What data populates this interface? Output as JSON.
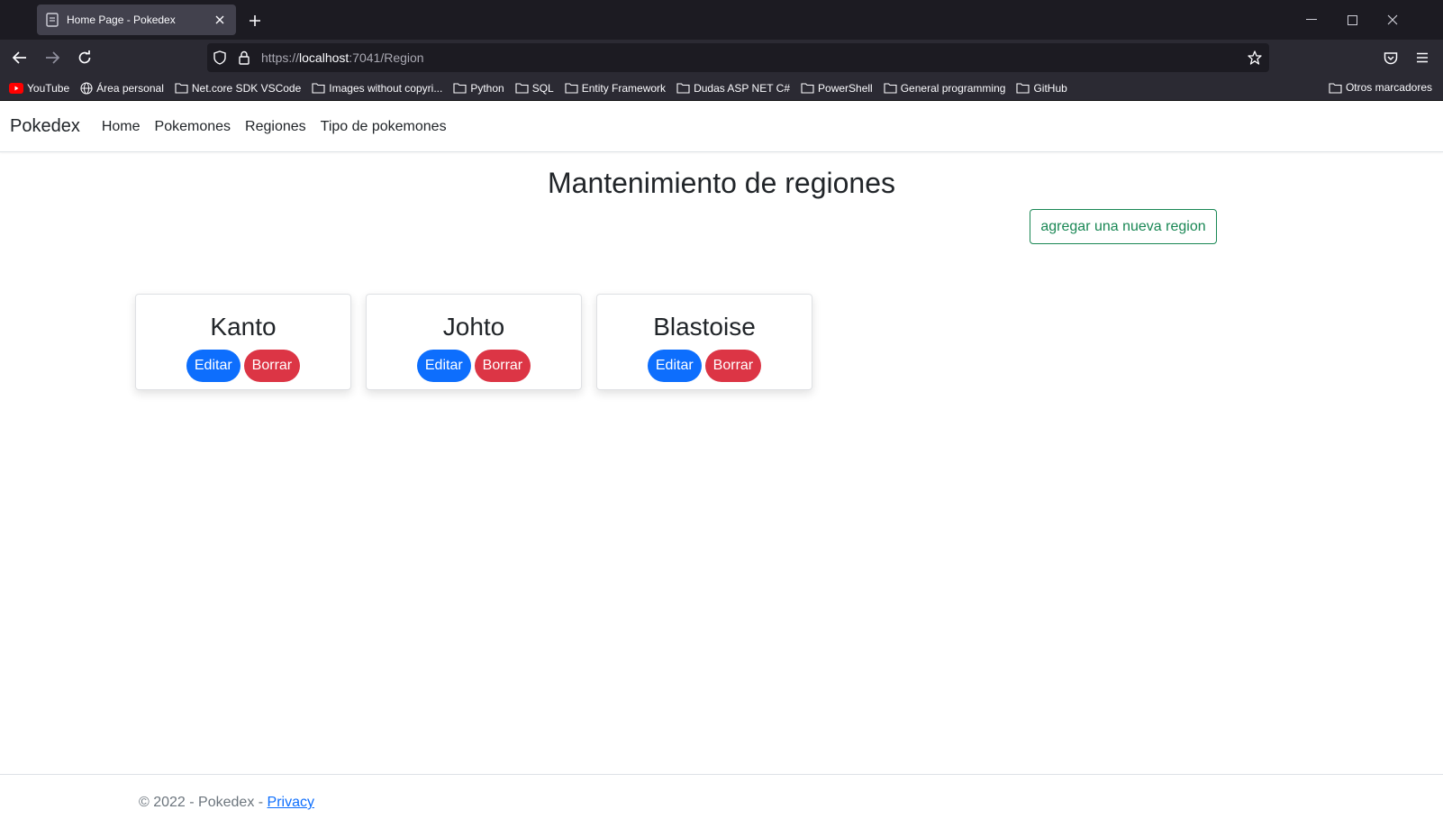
{
  "browser": {
    "tab_title": "Home Page - Pokedex",
    "url_prefix": "https://",
    "url_host": "localhost",
    "url_rest": ":7041/Region",
    "bookmarks": [
      {
        "label": "YouTube",
        "icon": "youtube-icon"
      },
      {
        "label": "Área personal",
        "icon": "globe-icon"
      },
      {
        "label": "Net.core SDK VSCode",
        "icon": "folder-icon"
      },
      {
        "label": "Images without copyri...",
        "icon": "folder-icon"
      },
      {
        "label": "Python",
        "icon": "folder-icon"
      },
      {
        "label": "SQL",
        "icon": "folder-icon"
      },
      {
        "label": "Entity Framework",
        "icon": "folder-icon"
      },
      {
        "label": "Dudas ASP NET C#",
        "icon": "folder-icon"
      },
      {
        "label": "PowerShell",
        "icon": "folder-icon"
      },
      {
        "label": "General programming",
        "icon": "folder-icon"
      },
      {
        "label": "GitHub",
        "icon": "folder-icon"
      }
    ],
    "other_bookmarks": "Otros marcadores"
  },
  "site": {
    "brand": "Pokedex",
    "nav": [
      "Home",
      "Pokemones",
      "Regiones",
      "Tipo de pokemones"
    ],
    "heading": "Mantenimiento de regiones",
    "add_button": "agregar una nueva region",
    "regions": [
      {
        "name": "Kanto",
        "edit": "Editar",
        "delete": "Borrar"
      },
      {
        "name": "Johto",
        "edit": "Editar",
        "delete": "Borrar"
      },
      {
        "name": "Blastoise",
        "edit": "Editar",
        "delete": "Borrar"
      }
    ],
    "footer_text": "© 2022 - Pokedex - ",
    "footer_link": "Privacy"
  },
  "colors": {
    "primary": "#0d6efd",
    "danger": "#dc3545",
    "success": "#198754"
  }
}
